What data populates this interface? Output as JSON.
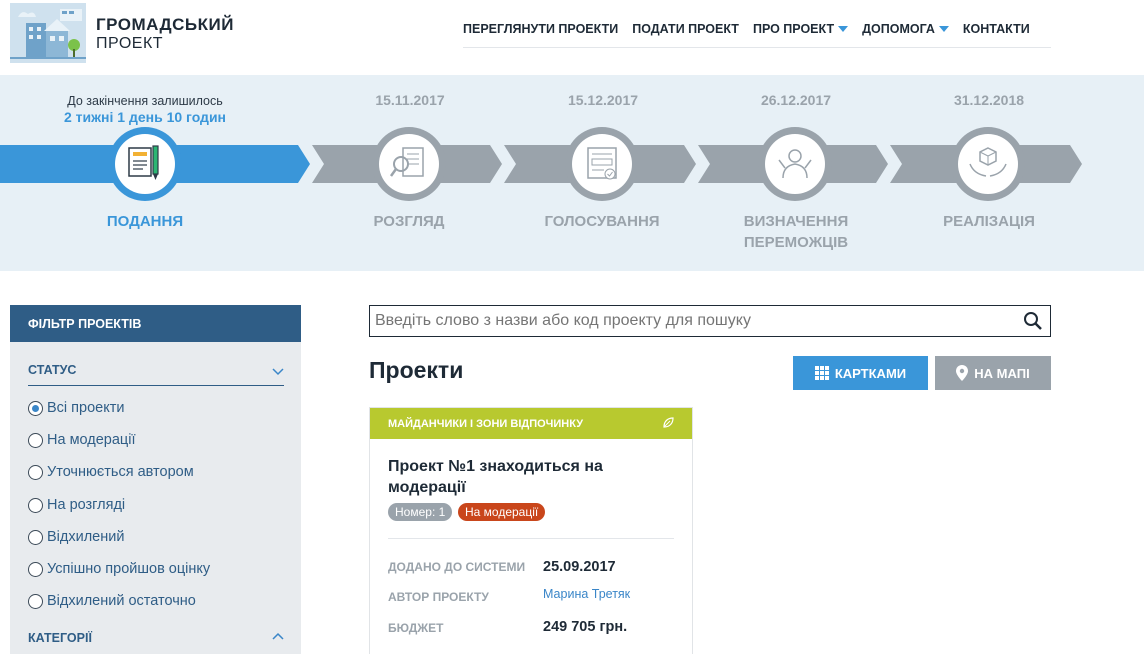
{
  "header": {
    "logo_title": "ГРОМАДСЬКИЙ",
    "logo_subtitle": "ПРОЕКТ",
    "nav": [
      {
        "label": "ПЕРЕГЛЯНУТИ ПРОЕКТИ",
        "dropdown": false
      },
      {
        "label": "ПОДАТИ ПРОЕКТ",
        "dropdown": false
      },
      {
        "label": "ПРО ПРОЕКТ",
        "dropdown": true
      },
      {
        "label": "ДОПОМОГА",
        "dropdown": true
      },
      {
        "label": "КОНТАКТИ",
        "dropdown": false
      }
    ]
  },
  "timeline": {
    "remaining_label": "До закінчення залишилось",
    "remaining_value": "2 тижні 1 день 10 годин",
    "stages": [
      {
        "name": "ПОДАННЯ",
        "date": "",
        "icon": "document-pen-icon",
        "active": true
      },
      {
        "name": "РОЗГЛЯД",
        "date": "15.11.2017",
        "icon": "magnifier-document-icon",
        "active": false
      },
      {
        "name": "ГОЛОСУВАННЯ",
        "date": "15.12.2017",
        "icon": "ballot-icon",
        "active": false
      },
      {
        "name": "ВИЗНАЧЕННЯ ПЕРЕМОЖЦІВ",
        "date": "26.12.2017",
        "icon": "winner-icon",
        "active": false
      },
      {
        "name": "РЕАЛІЗАЦІЯ",
        "date": "31.12.2018",
        "icon": "hands-cube-icon",
        "active": false
      }
    ]
  },
  "sidebar": {
    "title": "ФІЛЬТР ПРОЕКТІВ",
    "status_label": "СТАТУС",
    "statuses": [
      {
        "label": "Всі проекти",
        "checked": true
      },
      {
        "label": "На модерації",
        "checked": false
      },
      {
        "label": "Уточнюється автором",
        "checked": false
      },
      {
        "label": "На розгляді",
        "checked": false
      },
      {
        "label": "Відхилений",
        "checked": false
      },
      {
        "label": "Успішно пройшов оцінку",
        "checked": false
      },
      {
        "label": "Відхилений остаточно",
        "checked": false
      }
    ],
    "categories_label": "КАТЕГОРІЇ"
  },
  "main": {
    "search_placeholder": "Введіть слово з назви або код проекту для пошуку",
    "title": "Проекти",
    "btn_cards": "КАРТКАМИ",
    "btn_map": "НА МАПІ"
  },
  "card": {
    "category": "МАЙДАНЧИКИ І ЗОНИ ВІДПОЧИНКУ",
    "title": "Проект №1 знаходиться на модерації",
    "number_badge": "Номер: 1",
    "status_badge": "На модерації",
    "added_label": "ДОДАНО ДО СИСТЕМИ",
    "added_value": "25.09.2017",
    "author_label": "АВТОР ПРОЕКТУ",
    "author_value": "Марина Третяк",
    "budget_label": "БЮДЖЕТ",
    "budget_value": "249 705 грн."
  },
  "colors": {
    "accent": "#3a96d9",
    "sidebar_head": "#2f5d86",
    "category": "#b8c92f",
    "moderation": "#c9461b",
    "inactive": "#9aa3ab"
  }
}
